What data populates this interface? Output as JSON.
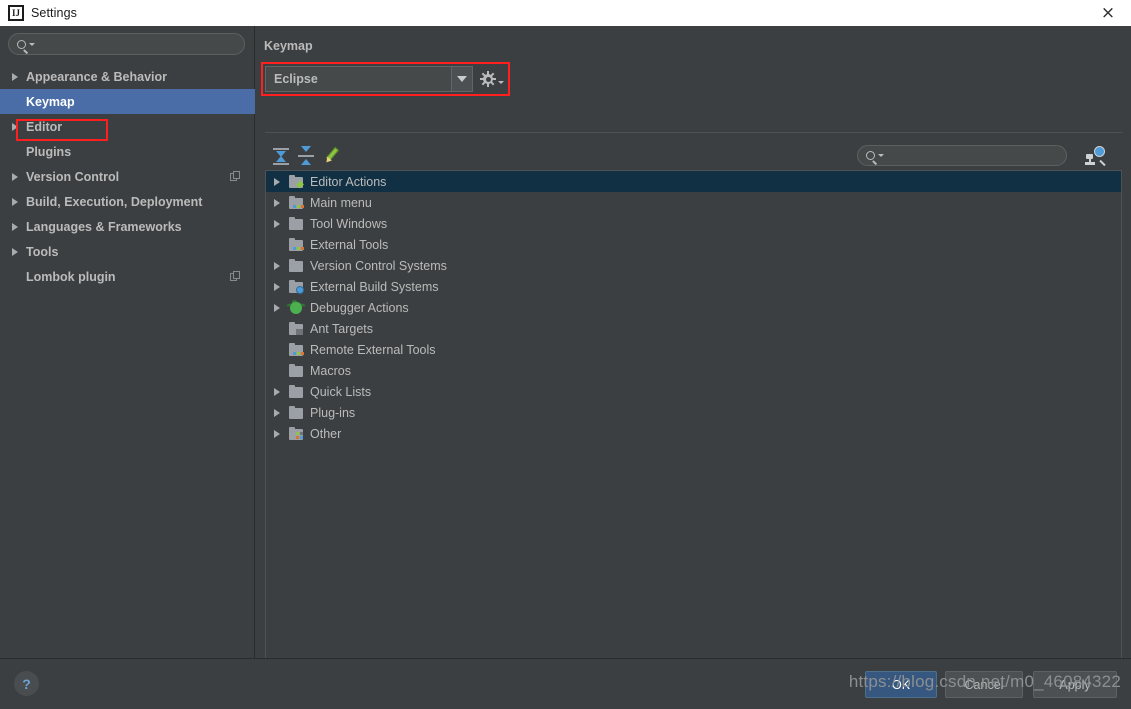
{
  "window": {
    "title": "Settings",
    "logo_text": "IJ",
    "close_icon": "×"
  },
  "sidebar": {
    "search_placeholder": "",
    "items": [
      {
        "label": "Appearance & Behavior",
        "expandable": true,
        "selected": false,
        "badge": false
      },
      {
        "label": "Keymap",
        "expandable": false,
        "selected": true,
        "badge": false
      },
      {
        "label": "Editor",
        "expandable": true,
        "selected": false,
        "badge": false
      },
      {
        "label": "Plugins",
        "expandable": false,
        "selected": false,
        "badge": false
      },
      {
        "label": "Version Control",
        "expandable": true,
        "selected": false,
        "badge": true
      },
      {
        "label": "Build, Execution, Deployment",
        "expandable": true,
        "selected": false,
        "badge": false
      },
      {
        "label": "Languages & Frameworks",
        "expandable": true,
        "selected": false,
        "badge": false
      },
      {
        "label": "Tools",
        "expandable": true,
        "selected": false,
        "badge": false
      },
      {
        "label": "Lombok plugin",
        "expandable": false,
        "selected": false,
        "badge": true
      }
    ]
  },
  "panel": {
    "title": "Keymap",
    "keymap_select": {
      "value": "Eclipse",
      "dropdown_icon": "chevron-down-icon",
      "gear_icon": "gear-icon"
    },
    "toolbar": {
      "expand_all_tooltip": "Expand All",
      "collapse_all_tooltip": "Collapse All",
      "edit_tooltip": "Edit Shortcut",
      "search_placeholder": "",
      "find_by_shortcut_tooltip": "Find Actions by Shortcut"
    },
    "tree": [
      {
        "label": "Editor Actions",
        "expandable": true,
        "selected": true,
        "icon": "folder-editor"
      },
      {
        "label": "Main menu",
        "expandable": true,
        "selected": false,
        "icon": "folder-menu"
      },
      {
        "label": "Tool Windows",
        "expandable": true,
        "selected": false,
        "icon": "folder"
      },
      {
        "label": "External Tools",
        "expandable": false,
        "selected": false,
        "icon": "folder-tools"
      },
      {
        "label": "Version Control Systems",
        "expandable": true,
        "selected": false,
        "icon": "folder"
      },
      {
        "label": "External Build Systems",
        "expandable": true,
        "selected": false,
        "icon": "folder-build"
      },
      {
        "label": "Debugger Actions",
        "expandable": true,
        "selected": false,
        "icon": "bug"
      },
      {
        "label": "Ant Targets",
        "expandable": false,
        "selected": false,
        "icon": "folder-ant"
      },
      {
        "label": "Remote External Tools",
        "expandable": false,
        "selected": false,
        "icon": "folder-tools"
      },
      {
        "label": "Macros",
        "expandable": false,
        "selected": false,
        "icon": "folder"
      },
      {
        "label": "Quick Lists",
        "expandable": true,
        "selected": false,
        "icon": "folder"
      },
      {
        "label": "Plug-ins",
        "expandable": true,
        "selected": false,
        "icon": "folder"
      },
      {
        "label": "Other",
        "expandable": true,
        "selected": false,
        "icon": "folder-other"
      }
    ]
  },
  "footer": {
    "help_label": "?",
    "ok_label": "OK",
    "cancel_label": "Cancel",
    "apply_label": "Apply",
    "watermark": "https://blog.csdn.net/m0_46084322"
  },
  "colors": {
    "window_bg": "#3c3f41",
    "sidebar_selected": "#4a6da7",
    "tree_selected": "#123043",
    "highlight_box": "#ff1f1f",
    "accent_button": "#365880",
    "text": "#bbbbbb"
  }
}
